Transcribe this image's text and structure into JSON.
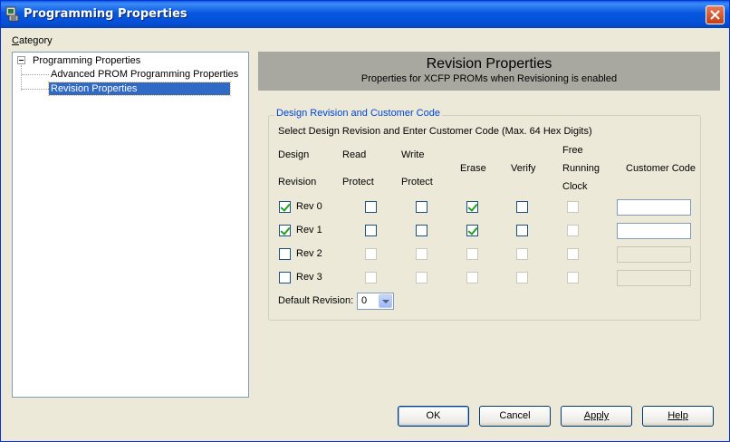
{
  "window": {
    "title": "Programming Properties"
  },
  "category": {
    "label": "Category",
    "accel": "C",
    "rest": "ategory"
  },
  "tree": {
    "root": "Programming Properties",
    "children": [
      "Advanced PROM Programming Properties",
      "Revision Properties"
    ],
    "selected": "Revision Properties"
  },
  "banner": {
    "title": "Revision Properties",
    "subtitle": "Properties for XCFP PROMs when Revisioning is enabled"
  },
  "group": {
    "title": "Design Revision and Customer Code",
    "instruction": "Select Design Revision and Enter Customer Code (Max. 64 Hex Digits)"
  },
  "columns": {
    "design_1": "Design",
    "design_2": "Revision",
    "read_1": "Read",
    "read_2": "Protect",
    "write_1": "Write",
    "write_2": "Protect",
    "erase": "Erase",
    "verify": "Verify",
    "free_1": "Free",
    "free_2": "Running",
    "free_3": "Clock",
    "code": "Customer Code"
  },
  "rows": [
    {
      "label": "Rev 0",
      "design": true,
      "read": false,
      "write": false,
      "erase": true,
      "verify": false,
      "free": false,
      "code": "",
      "enabled": true
    },
    {
      "label": "Rev 1",
      "design": true,
      "read": false,
      "write": false,
      "erase": true,
      "verify": false,
      "free": false,
      "code": "",
      "enabled": true
    },
    {
      "label": "Rev 2",
      "design": false,
      "read": false,
      "write": false,
      "erase": false,
      "verify": false,
      "free": false,
      "code": "",
      "enabled": false
    },
    {
      "label": "Rev 3",
      "design": false,
      "read": false,
      "write": false,
      "erase": false,
      "verify": false,
      "free": false,
      "code": "",
      "enabled": false
    }
  ],
  "default_revision": {
    "label": "Default Revision:",
    "value": "0"
  },
  "buttons": {
    "ok": "OK",
    "cancel": "Cancel",
    "apply": "Apply",
    "help": "Help"
  },
  "colors": {
    "title_bar": "#0757e0",
    "selection": "#316ac5",
    "group_title": "#0046d5",
    "banner": "#a8a8a0",
    "check": "#21a121"
  }
}
